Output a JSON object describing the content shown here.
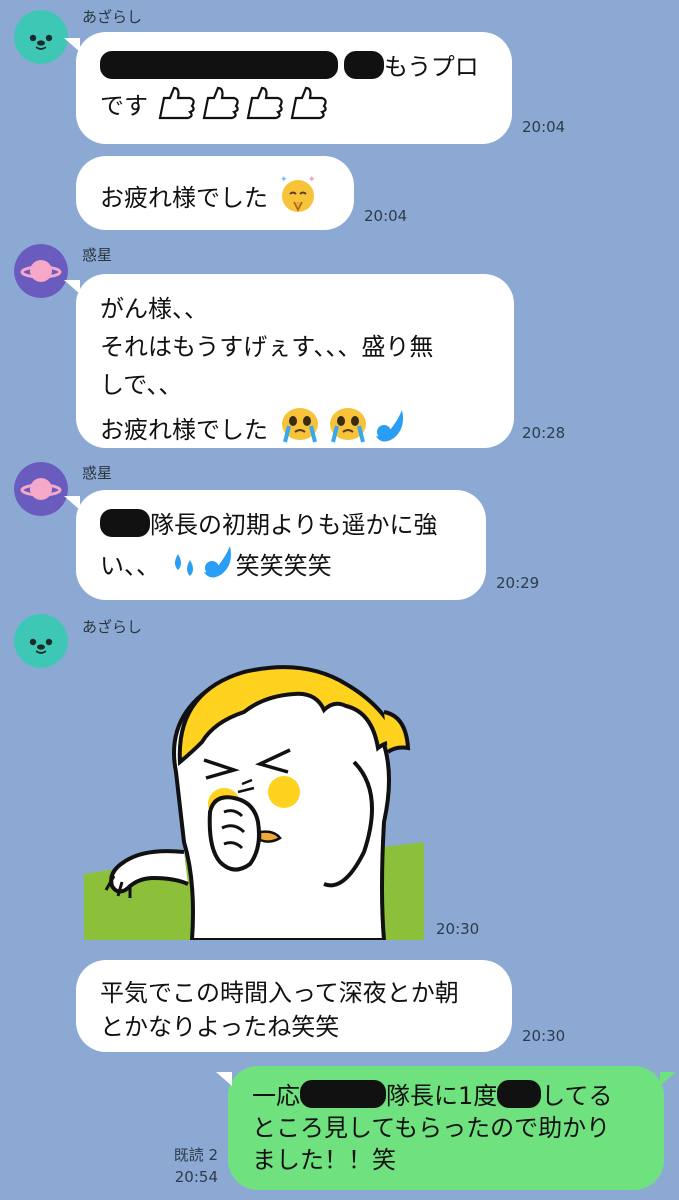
{
  "messages": {
    "m1": {
      "sender": "あざらし",
      "line1_text": "もうプロ",
      "line2_text": "です",
      "thumbs_icons": [
        "thumbs-up",
        "thumbs-up",
        "thumbs-up",
        "thumbs-up"
      ],
      "time": "20:04"
    },
    "m2": {
      "text": "お疲れ様でした",
      "icon": "praying-face-emoji",
      "time": "20:04"
    },
    "m3": {
      "sender": "惑星",
      "line1": "がん様、、",
      "line2": "それはもうすげぇす、、、盛り無",
      "line3": "しで、、",
      "line4": "お疲れ様でした",
      "time": "20:28"
    },
    "m4": {
      "sender": "惑星",
      "line1_text": "隊長の初期よりも遥かに強",
      "line2_prefix": "い、、",
      "line2_suffix": "笑笑笑笑",
      "time": "20:29"
    },
    "m5": {
      "sender": "あざらし",
      "sticker": "sneezing-character-sticker",
      "time": "20:30"
    },
    "m6": {
      "line1": "平気でこの時間入って深夜とか朝",
      "line2": "とかなりよったね笑笑",
      "time": "20:30"
    },
    "m7": {
      "line1_a": "一応",
      "line1_b": "隊長に1度",
      "line1_c": "してる",
      "line2": "ところ見してもらったので助かり",
      "line3": "ました！！笑",
      "read": "既読 2",
      "time": "20:54"
    }
  },
  "colors": {
    "background": "#8ca9d4",
    "bubble_other": "#ffffff",
    "bubble_mine": "#6fe17f",
    "avatar_seal": "#3fc7b6",
    "avatar_planet": "#6a5bbf"
  }
}
